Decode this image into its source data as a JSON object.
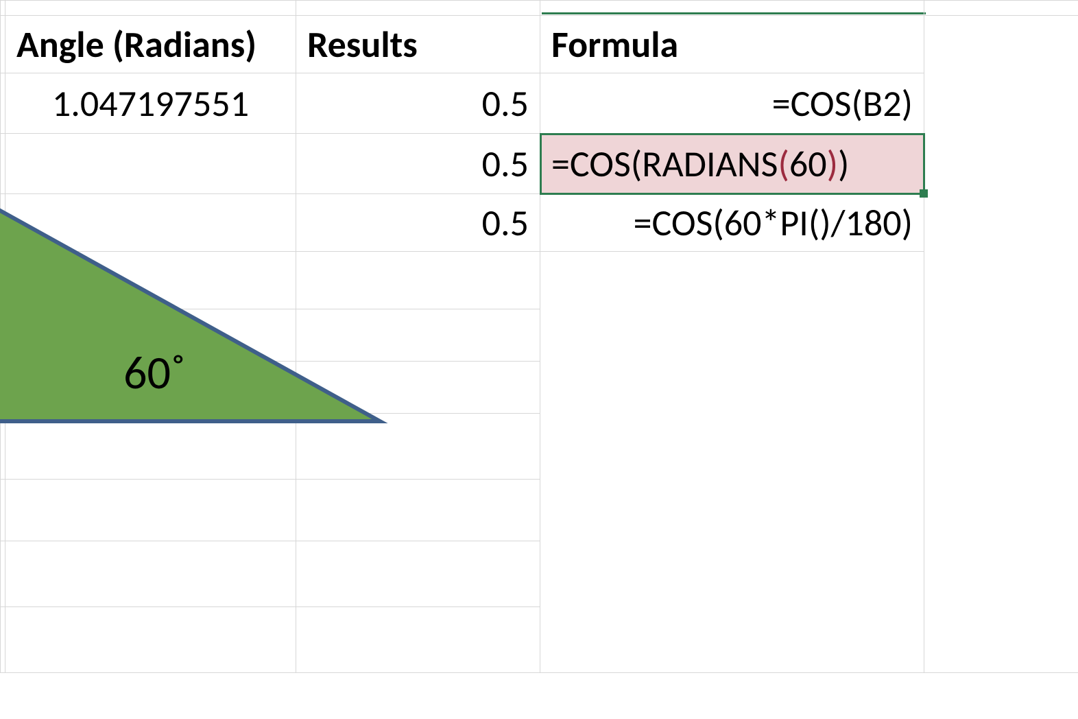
{
  "headers": {
    "angle": "Angle (Radians)",
    "results": "Results",
    "formula": "Formula"
  },
  "rows": [
    {
      "angle": "1.047197551",
      "result": "0.5",
      "formula": "=COS(B2)"
    },
    {
      "angle": "",
      "result": "0.5",
      "formula": "=COS(RADIANS(60))"
    },
    {
      "angle": "",
      "result": "0.5",
      "formula": "=COS(60*PI()/180)"
    }
  ],
  "active_formula_parts": {
    "prefix": "=COS(RADIANS",
    "lparen": "(",
    "arg": "60",
    "rparen1": ")",
    "rparen2": ")"
  },
  "triangle": {
    "angle_label": "60˚",
    "fill": "#6da34d",
    "stroke": "#3f5f8a"
  }
}
